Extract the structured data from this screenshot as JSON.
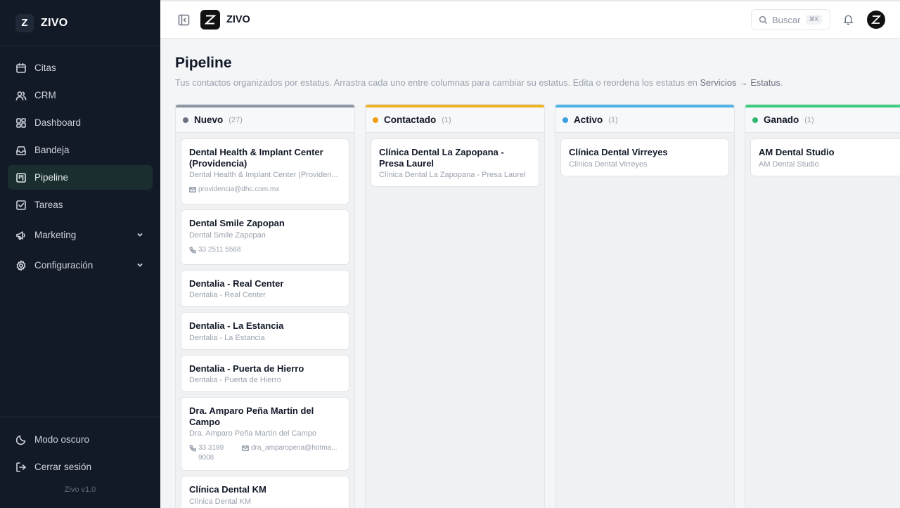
{
  "sidebar": {
    "brand": "ZIVO",
    "logo_letter": "Z",
    "items": [
      {
        "label": "Citas"
      },
      {
        "label": "CRM"
      },
      {
        "label": "Dashboard"
      },
      {
        "label": "Bandeja"
      },
      {
        "label": "Pipeline",
        "active": true
      },
      {
        "label": "Tareas"
      },
      {
        "label": "Marketing"
      },
      {
        "label": "Configuración"
      }
    ],
    "bottom": {
      "dark_mode": "Modo oscuro",
      "logout": "Cerrar sesión",
      "version": "Zivo v1.0"
    }
  },
  "topbar": {
    "brand": "ZIVO",
    "search_label": "Buscar",
    "search_shortcut": "⌘K"
  },
  "page": {
    "title": "Pipeline",
    "desc_prefix": "Tus contactos organizados por estatus. Arrastra cada uno entre columnas para cambiar su estatus. Edita o reordena los estatus en ",
    "desc_link": "Servicios → Estatus",
    "desc_suffix": "."
  },
  "columns": [
    {
      "name": "Nuevo",
      "count": "(27)",
      "color": "#8e96a4",
      "dot": "#6b7280",
      "cards": [
        {
          "title": "Dental Health & Implant Center (Providencia)",
          "subtitle": "Dental Health & Implant Center (Providen...",
          "email": "providencia@dhc.com.mx"
        },
        {
          "title": "Dental Smile Zapopan",
          "subtitle": "Dental Smile Zapopan",
          "phone": "33 2511 5568"
        },
        {
          "title": "Dentalia - Real Center",
          "subtitle": "Dentalia - Real Center"
        },
        {
          "title": "Dentalia - La Estancia",
          "subtitle": "Dentalia - La Estancia"
        },
        {
          "title": "Dentalia - Puerta de Hierro",
          "subtitle": "Dentalia - Puerta de Hierro"
        },
        {
          "title": "Dra. Amparo Peña Martín del Campo",
          "subtitle": "Dra. Amparo Peña Martín del Campo",
          "phone": "33 3189 9008",
          "email": "dra_amparopena@hotma..."
        },
        {
          "title": "Clínica Dental KM",
          "subtitle": "Clínica Dental KM"
        }
      ]
    },
    {
      "name": "Contactado",
      "count": "(1)",
      "color": "#f0b429",
      "dot": "#f59e0b",
      "cards": [
        {
          "title": "Clínica Dental La Zapopana - Presa Laurel",
          "subtitle": "Clínica Dental La Zapopana - Presa Laurel"
        }
      ]
    },
    {
      "name": "Activo",
      "count": "(1)",
      "color": "#4fb3ea",
      "dot": "#3b9ee0",
      "cards": [
        {
          "title": "Clínica Dental Virreyes",
          "subtitle": "Clínica Dental Virreyes"
        }
      ]
    },
    {
      "name": "Ganado",
      "count": "(1)",
      "color": "#3ccf7f",
      "dot": "#2fb872",
      "cards": [
        {
          "title": "AM Dental Studio",
          "subtitle": "AM Dental Studio"
        }
      ]
    }
  ]
}
